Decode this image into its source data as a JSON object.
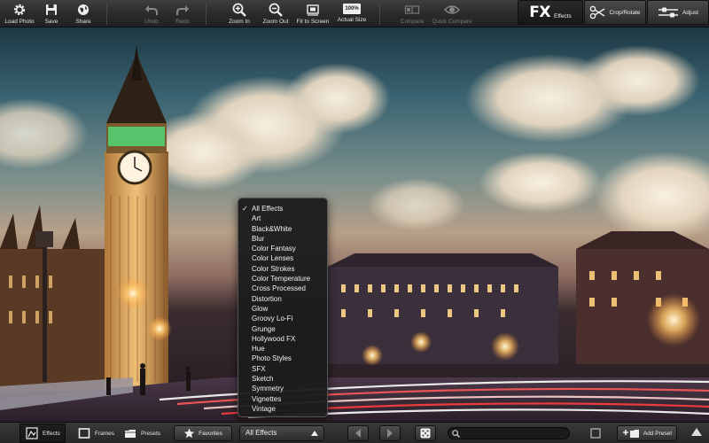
{
  "toolbar": {
    "load_photo": "Load Photo",
    "save": "Save",
    "share": "Share",
    "undo": "Undo",
    "redo": "Redo",
    "zoom_in": "Zoom In",
    "zoom_out": "Zoom Out",
    "fit_to_screen": "Fit to Screen",
    "actual_size": "Actual Size",
    "actual_size_badge": "100%",
    "compare": "Compare",
    "quick_compare": "Quick Compare"
  },
  "modes": {
    "effects_logo": "FX",
    "effects": "Effects",
    "crop_rotate": "Crop/Rotate",
    "adjust": "Adjust"
  },
  "menu": {
    "selected": "All Effects",
    "items": [
      "All Effects",
      "Art",
      "Black&White",
      "Blur",
      "Color Fantasy",
      "Color Lenses",
      "Color Strokes",
      "Color Temperature",
      "Cross Processed",
      "Distortion",
      "Glow",
      "Groovy Lo-Fi",
      "Grunge",
      "Hollywood FX",
      "Hue",
      "Photo Styles",
      "SFX",
      "Sketch",
      "Symmetry",
      "Vignettes",
      "Vintage"
    ]
  },
  "bottombar": {
    "effects_tab": "Effects",
    "frames_tab": "Frames",
    "presets_tab": "Presets",
    "favorites": "Favorites",
    "category_select": "All Effects",
    "search_placeholder": "",
    "add_preset": "Add Preset"
  },
  "colors": {
    "toolbar_bg": "#2a2a2a",
    "menu_bg": "#1c1c1c",
    "accent_text": "#f2f2f2"
  }
}
